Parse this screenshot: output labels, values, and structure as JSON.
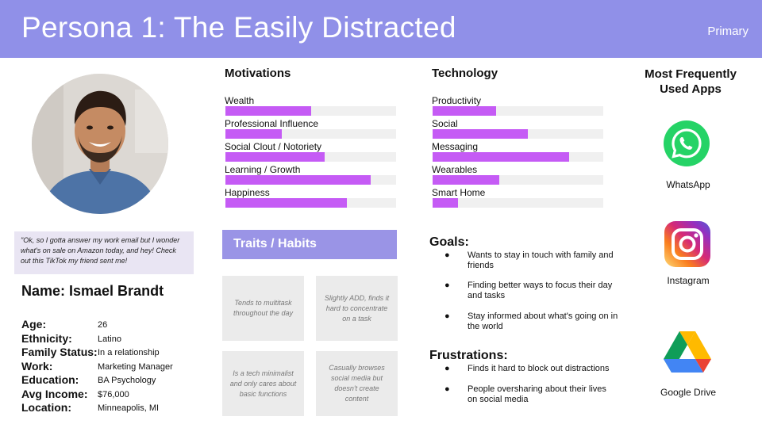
{
  "header": {
    "title": "Persona 1: The Easily Distracted",
    "tag": "Primary"
  },
  "quote": "\"Ok, so I gotta answer my work email but I wonder what's on sale on Amazon today, and hey! Check out this TikTok my friend sent me!",
  "name": "Name: Ismael Brandt",
  "details": [
    {
      "label": "Age:",
      "value": "26"
    },
    {
      "label": "Ethnicity:",
      "value": "Latino"
    },
    {
      "label": "Family Status:",
      "value": "In a relationship"
    },
    {
      "label": "Work:",
      "value": "Marketing Manager"
    },
    {
      "label": "Education:",
      "value": "BA Psychology"
    },
    {
      "label": "Avg Income:",
      "value": "$76,000"
    },
    {
      "label": "Location:",
      "value": "Minneapolis, MI"
    }
  ],
  "motivations": {
    "title": "Motivations",
    "items": [
      {
        "label": "Wealth",
        "level": 0.5
      },
      {
        "label": "Professional Influence",
        "level": 0.33
      },
      {
        "label": "Social Clout / Notoriety",
        "level": 0.58
      },
      {
        "label": "Learning / Growth",
        "level": 0.85
      },
      {
        "label": "Happiness",
        "level": 0.71
      }
    ]
  },
  "technology": {
    "title": "Technology",
    "items": [
      {
        "label": "Productivity",
        "level": 0.37
      },
      {
        "label": "Social",
        "level": 0.56
      },
      {
        "label": "Messaging",
        "level": 0.8
      },
      {
        "label": "Wearables",
        "level": 0.39
      },
      {
        "label": "Smart Home",
        "level": 0.15
      }
    ]
  },
  "traits": {
    "title": "Traits / Habits",
    "cards": [
      "Tends to multitask throughout the day",
      "Slightly ADD, finds it hard to concentrate on a task",
      "Is a tech minimalist and only cares about basic functions",
      "Casually browses social media but doesn't create content"
    ]
  },
  "goals": {
    "title": "Goals:",
    "items": [
      "Wants to stay in touch with family and friends",
      "Finding better ways to focus their day and tasks",
      "Stay informed about what's going on in the world"
    ]
  },
  "frustrations": {
    "title": "Frustrations:",
    "items": [
      "Finds it hard to block out distractions",
      "People oversharing about their lives on social media"
    ]
  },
  "apps": {
    "title": "Most Frequently Used Apps",
    "items": [
      {
        "label": "WhatsApp",
        "icon": "whatsapp-icon"
      },
      {
        "label": "Instagram",
        "icon": "instagram-icon"
      },
      {
        "label": "Google Drive",
        "icon": "google-drive-icon"
      }
    ]
  },
  "bullet_symbol": "●",
  "colors": {
    "header": "#9090e8",
    "bar": "#c55bf5",
    "traits_header": "#9a94e6",
    "quote_bg": "#e9e5f3"
  }
}
